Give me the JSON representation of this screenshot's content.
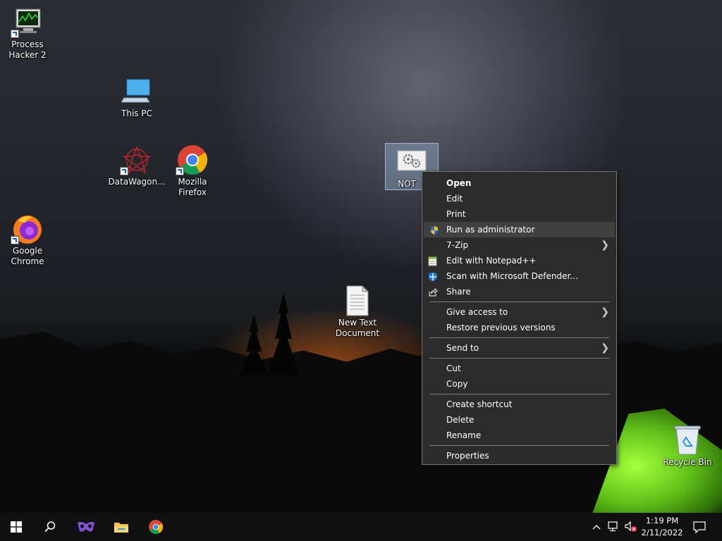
{
  "desktop": {
    "icons": [
      {
        "label": "Process\nHacker 2",
        "line1": "Process",
        "line2": "Hacker 2"
      },
      {
        "line1": "This PC"
      },
      {
        "line1": "DataWagon..."
      },
      {
        "line1": "Mozilla",
        "line2": "Firefox"
      },
      {
        "line1": "Google",
        "line2": "Chrome"
      },
      {
        "line1": "New Text",
        "line2": "Document"
      },
      {
        "line1": "NOT"
      },
      {
        "line1": "Recycle Bin"
      }
    ]
  },
  "context_menu": {
    "items": {
      "open": "Open",
      "edit": "Edit",
      "print": "Print",
      "run_admin": "Run as administrator",
      "zip": "7-Zip",
      "notepadpp": "Edit with Notepad++",
      "defender": "Scan with Microsoft Defender...",
      "share": "Share",
      "give_access": "Give access to",
      "restore": "Restore previous versions",
      "send_to": "Send to",
      "cut": "Cut",
      "copy": "Copy",
      "create_shortcut": "Create shortcut",
      "delete": "Delete",
      "rename": "Rename",
      "properties": "Properties"
    }
  },
  "taskbar": {
    "time": "1:19 PM",
    "date": "2/11/2022"
  },
  "colors": {
    "menu_bg": "#2b2b2b",
    "menu_hover": "#414141",
    "taskbar_bg": "#101010"
  }
}
